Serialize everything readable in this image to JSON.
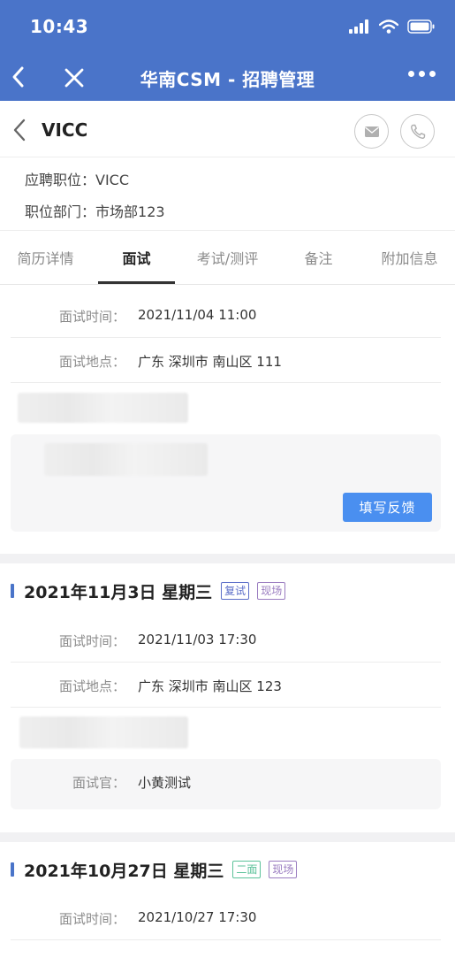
{
  "status_bar": {
    "time": "10:43"
  },
  "nav": {
    "title": "华南CSM - 招聘管理"
  },
  "candidate": {
    "name": "VICC",
    "position_label": "应聘职位：",
    "position_value": "VICC",
    "dept_label": "职位部门：",
    "dept_value": "市场部123"
  },
  "tabs": [
    "简历详情",
    "面试",
    "考试/测评",
    "备注",
    "附加信息"
  ],
  "interview_current": {
    "time_label": "面试时间：",
    "time_value": "2021/11/04 11:00",
    "place_label": "面试地点：",
    "place_value": "广东 深圳市 南山区 111",
    "feedback_button": "填写反馈"
  },
  "interview_2": {
    "date": "2021年11月3日  星期三",
    "tags": [
      "复试",
      "现场"
    ],
    "time_label": "面试时间：",
    "time_value": "2021/11/03 17:30",
    "place_label": "面试地点：",
    "place_value": "广东 深圳市 南山区 123",
    "interviewer_label": "面试官：",
    "interviewer_value": "小黄测试"
  },
  "interview_3": {
    "date": "2021年10月27日  星期三",
    "tags": [
      "二面",
      "现场"
    ],
    "time_label": "面试时间：",
    "time_value": "2021/10/27 17:30"
  },
  "colors": {
    "app_bar": "#4a74c9",
    "feedback_button": "#4a8ff0",
    "tag_blue": "#5b6ec8",
    "tag_purple": "#9a7cc0",
    "tag_green": "#5cc29a"
  }
}
